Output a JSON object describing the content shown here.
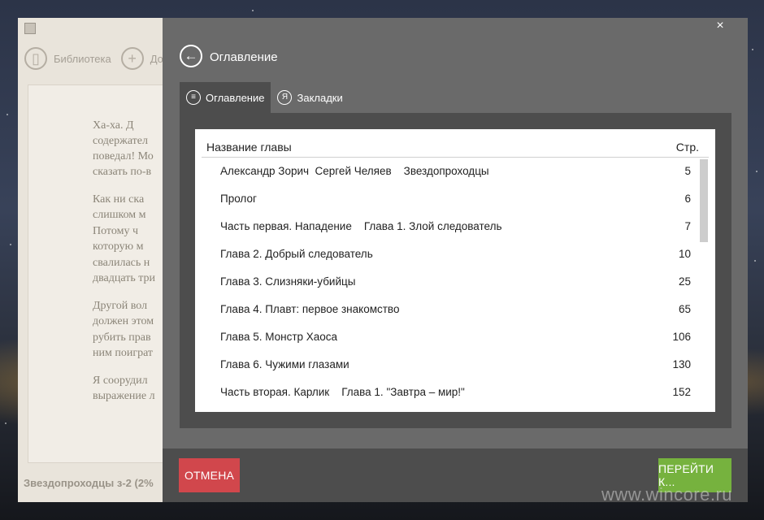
{
  "reader": {
    "toolbar": {
      "library_label": "Библиотека",
      "add_label": "До"
    },
    "page_paragraphs": [
      "Ха-ха.   Д",
      "содержател",
      "поведал! Мо",
      "сказать по-в",
      "Как  ни  ска",
      "слишком   м",
      "Потому    ч",
      "которую    м",
      "свалилась  н",
      "двадцать три",
      "Другой  вол",
      "должен этом",
      "рубить  прав",
      "ним поиграт",
      "Я  соорудил",
      "выражение л"
    ],
    "status": "Звездопроходцы з-2 (2%"
  },
  "dialog": {
    "title": "Оглавление",
    "close_glyph": "×",
    "back_glyph": "←",
    "tabs": [
      {
        "label": "Оглавление",
        "icon": "list-icon",
        "glyph": "≡",
        "active": true
      },
      {
        "label": "Закладки",
        "icon": "bookmark-icon",
        "glyph": "Я",
        "active": false
      }
    ],
    "table": {
      "col_name": "Название главы",
      "col_page": "Стр.",
      "rows": [
        {
          "name": "Александр Зорич  Сергей Челяев    Звездопроходцы",
          "page": "5"
        },
        {
          "name": "Пролог",
          "page": "6"
        },
        {
          "name": "Часть первая. Нападение    Глава 1. Злой следователь",
          "page": "7"
        },
        {
          "name": "Глава 2. Добрый следователь",
          "page": "10"
        },
        {
          "name": "Глава 3. Слизняки-убийцы",
          "page": "25"
        },
        {
          "name": "Глава 4. Плавт: первое знакомство",
          "page": "65"
        },
        {
          "name": "Глава 5. Монстр Хаоса",
          "page": "106"
        },
        {
          "name": "Глава 6. Чужими глазами",
          "page": "130"
        },
        {
          "name": "Часть вторая. Карлик    Глава 1. \"Завтра – мир!\"",
          "page": "152"
        }
      ]
    },
    "buttons": {
      "cancel": "ОТМЕНА",
      "go": "ПЕРЕЙТИ К..."
    }
  },
  "watermark": "www.wincore.ru",
  "colors": {
    "cancel": "#d1474c",
    "go": "#76b23e",
    "dialog_bg": "#6a6a6a",
    "panel_bg": "#4d4d4d"
  }
}
